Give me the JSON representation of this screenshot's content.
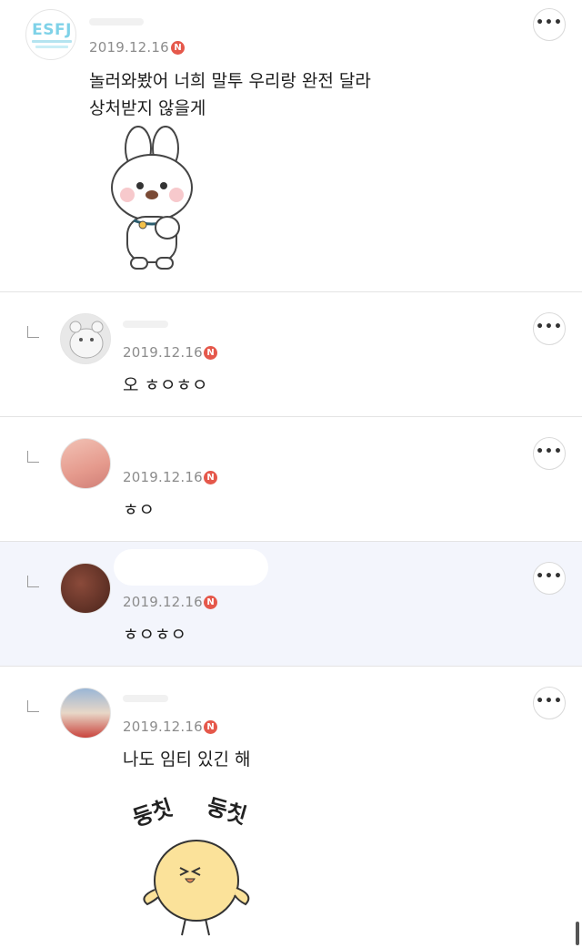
{
  "comments": [
    {
      "date": "2019.12.16",
      "badge": "N",
      "lines": [
        "놀러와봤어 너희 말투 우리랑 완전 달라",
        "상처받지 않을게"
      ],
      "avatar_text": "ESFJ",
      "sticker": "bunny-sticker"
    },
    {
      "date": "2019.12.16",
      "badge": "N",
      "text": "오 ㅎㅇㅎㅇ",
      "reply": true
    },
    {
      "date": "2019.12.16",
      "badge": "N",
      "text": "ㅎㅇ",
      "reply": true
    },
    {
      "date": "2019.12.16",
      "badge": "N",
      "text": "ㅎㅇㅎㅇ",
      "reply": true,
      "highlighted": true
    },
    {
      "date": "2019.12.16",
      "badge": "N",
      "text": "나도 임티 있긴 해",
      "reply": true,
      "sticker": "chick-sticker",
      "sticker_text": [
        "둥칫",
        "둥칫"
      ]
    }
  ],
  "more_label": "•••",
  "colors": {
    "badge": "#e5584b",
    "highlight": "#f3f5fc",
    "date": "#8c8c8c"
  }
}
